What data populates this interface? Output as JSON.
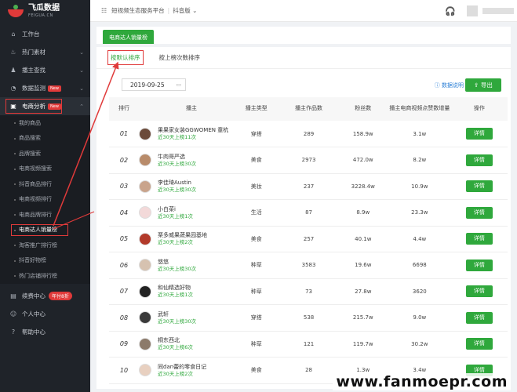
{
  "brand": {
    "name_cn": "飞瓜数据",
    "name_en": "FEIGUA.CN"
  },
  "sidebar": {
    "items": [
      {
        "label": "工作台",
        "icon": "home-icon",
        "caret": false
      },
      {
        "label": "热门素材",
        "icon": "fire-icon",
        "caret": true
      },
      {
        "label": "播主查找",
        "icon": "user-icon",
        "caret": true
      },
      {
        "label": "数据监测",
        "icon": "monitor-icon",
        "caret": true,
        "badge": "New"
      },
      {
        "label": "电商分析",
        "icon": "cart-icon",
        "caret": true,
        "badge": "New",
        "expanded": true
      }
    ],
    "subitems": [
      "我的商品",
      "商品搜索",
      "品牌搜索",
      "电商视频搜索",
      "抖音商品排行",
      "电商视频排行",
      "电商品牌排行",
      "电商达人销量榜",
      "淘客推广排行榜",
      "抖音好物榜",
      "热门店铺排行榜"
    ],
    "active_subitem_index": 7,
    "bottom_items": [
      {
        "label": "续费中心",
        "icon": "renew-icon",
        "badge": "年付8折"
      },
      {
        "label": "个人中心",
        "icon": "person-icon"
      },
      {
        "label": "帮助中心",
        "icon": "help-icon"
      }
    ]
  },
  "topbar": {
    "platform": "短视频生态服务平台",
    "version": "抖音版"
  },
  "page_tab": "电商达人销量榜",
  "sort_tabs": [
    "按默认排序",
    "按上榜次数排序"
  ],
  "active_sort_tab": 0,
  "date_value": "2019-09-25",
  "help_link": "数据说明",
  "export_label": "导出",
  "table": {
    "headers": [
      "排行",
      "播主",
      "播主类型",
      "播主作品数",
      "粉丝数",
      "播主电商视频点赞数增量",
      "操作"
    ],
    "rows": [
      {
        "rank": "01",
        "name": "果果家女装GGWOMEN 童杭",
        "note": "近30天上榜11次",
        "type": "穿搭",
        "works": "289",
        "fans": "158.9w",
        "likes": "3.1w",
        "avatar_color": "#6b4a3a"
      },
      {
        "rank": "02",
        "name": "牛肉哥严选",
        "note": "近30天上榜30次",
        "type": "美食",
        "works": "2973",
        "fans": "472.0w",
        "likes": "8.2w",
        "avatar_color": "#b88b6a"
      },
      {
        "rank": "03",
        "name": "李佳琦Austin",
        "note": "近30天上榜30次",
        "type": "美妆",
        "works": "237",
        "fans": "3228.4w",
        "likes": "10.9w",
        "avatar_color": "#c9a48c"
      },
      {
        "rank": "04",
        "name": "小白菜i",
        "note": "近30天上榜1次",
        "type": "生活",
        "works": "87",
        "fans": "8.9w",
        "likes": "23.3w",
        "avatar_color": "#f3d9d9"
      },
      {
        "rank": "05",
        "name": "栗多威果蔬果园基地",
        "note": "近30天上榜2次",
        "type": "美食",
        "works": "257",
        "fans": "40.1w",
        "likes": "4.4w",
        "avatar_color": "#b23a2a"
      },
      {
        "rank": "06",
        "name": "悠悠",
        "note": "近30天上榜30次",
        "type": "种草",
        "works": "3583",
        "fans": "19.6w",
        "likes": "6698",
        "avatar_color": "#d6c2b0"
      },
      {
        "rank": "07",
        "name": "和仙精选好物",
        "note": "近30天上榜1次",
        "type": "种草",
        "works": "73",
        "fans": "27.8w",
        "likes": "3620",
        "avatar_color": "#222222"
      },
      {
        "rank": "08",
        "name": "武轩",
        "note": "近30天上榜30次",
        "type": "穿搭",
        "works": "538",
        "fans": "215.7w",
        "likes": "9.0w",
        "avatar_color": "#3a3a3a"
      },
      {
        "rank": "09",
        "name": "桐东西北",
        "note": "近30天上榜6次",
        "type": "种草",
        "works": "121",
        "fans": "119.7w",
        "likes": "30.2w",
        "avatar_color": "#8c7a6a"
      },
      {
        "rank": "10",
        "name": "同dan蕾的零食日记",
        "note": "近30天上榜2次",
        "type": "美食",
        "works": "28",
        "fans": "1.3w",
        "likes": "3.4w",
        "avatar_color": "#e8d0c0"
      }
    ],
    "action_label": "详情"
  },
  "watermark": "www.fanmoepr.com",
  "colors": {
    "accent": "#2fa83c",
    "highlight": "#e03a3a",
    "sidebar_bg": "#1f2329"
  }
}
